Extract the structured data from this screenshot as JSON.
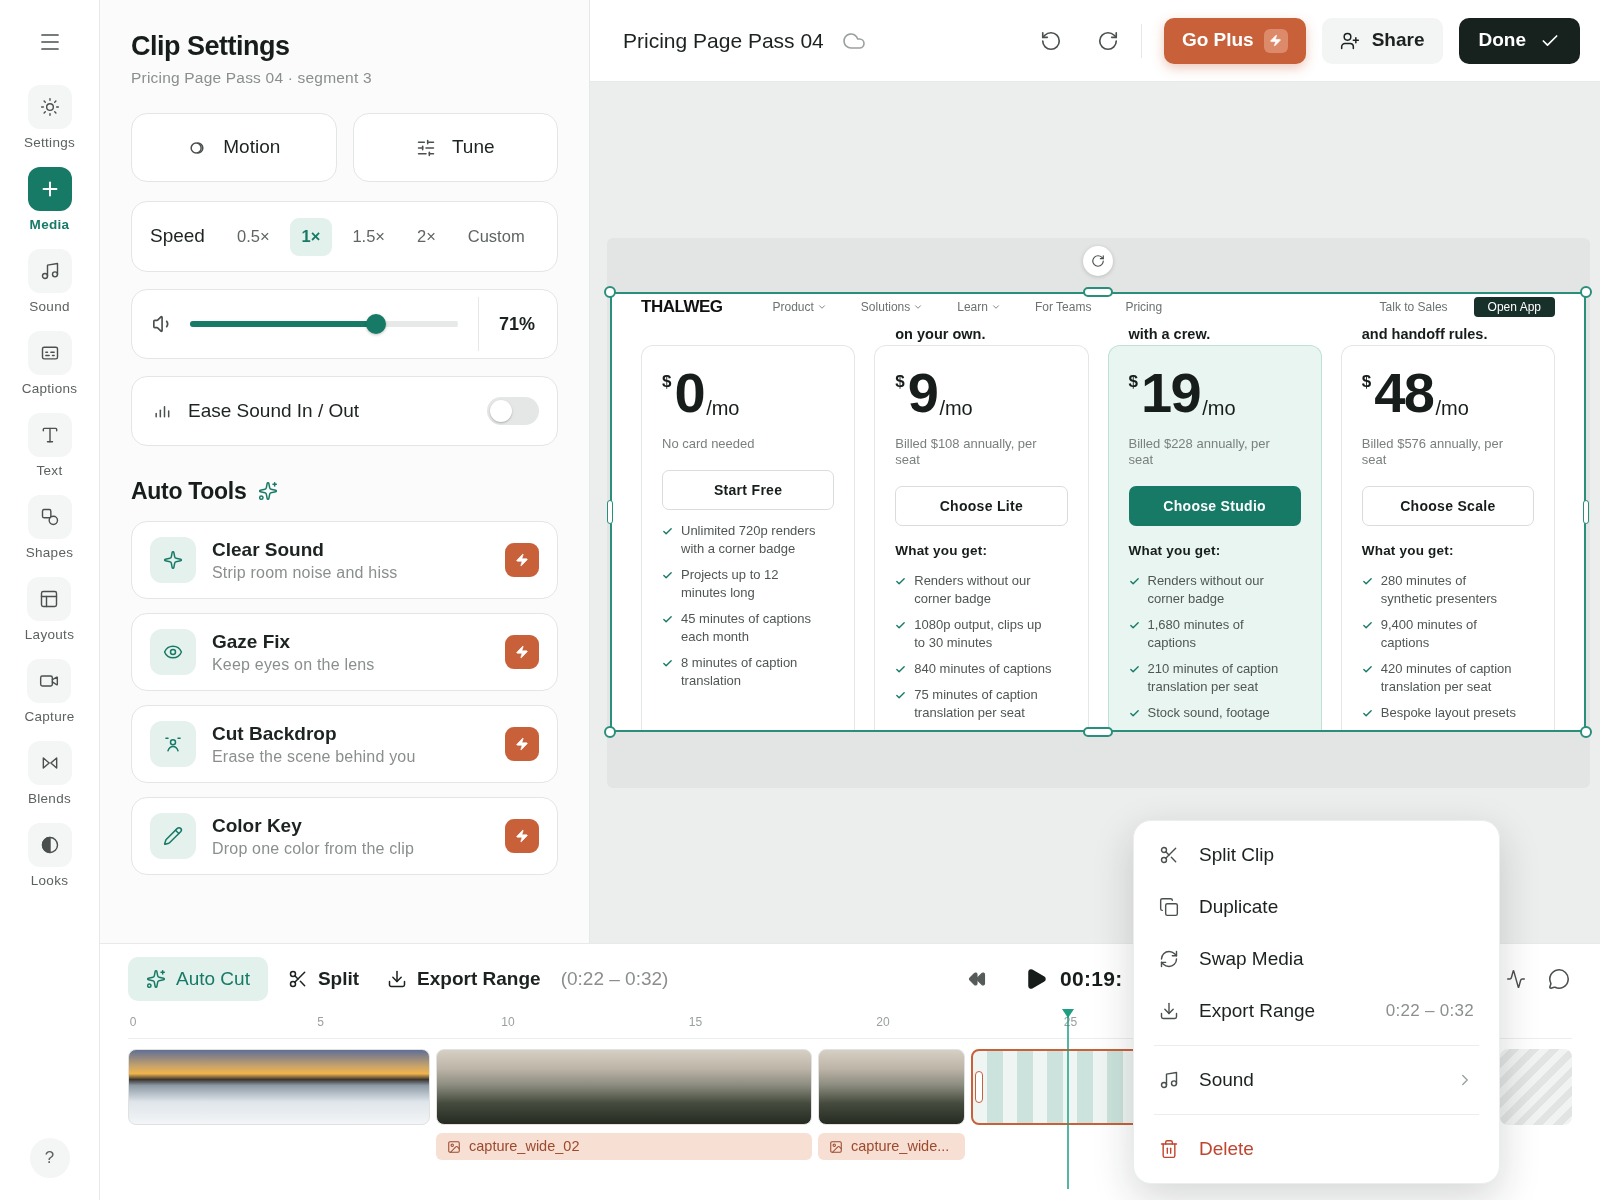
{
  "rail": {
    "items": [
      {
        "label": "Settings",
        "selected": false
      },
      {
        "label": "Media",
        "selected": true
      },
      {
        "label": "Sound",
        "selected": false
      },
      {
        "label": "Captions",
        "selected": false
      },
      {
        "label": "Text",
        "selected": false
      },
      {
        "label": "Shapes",
        "selected": false
      },
      {
        "label": "Layouts",
        "selected": false
      },
      {
        "label": "Capture",
        "selected": false
      },
      {
        "label": "Blends",
        "selected": false
      },
      {
        "label": "Looks",
        "selected": false
      }
    ],
    "help": "?"
  },
  "panel": {
    "title": "Clip Settings",
    "subtitle": "Pricing Page Pass 04 · segment 3",
    "modes": [
      "Motion",
      "Tune"
    ],
    "speed": {
      "label": "Speed",
      "options": [
        {
          "label": "0.5×",
          "selected": false
        },
        {
          "label": "1×",
          "selected": true
        },
        {
          "label": "1.5×",
          "selected": false
        },
        {
          "label": "2×",
          "selected": false
        },
        {
          "label": "Custom",
          "selected": false
        }
      ]
    },
    "volume": {
      "level": 0.71,
      "reading": "71%"
    },
    "ease": {
      "label": "Ease Sound In / Out",
      "on": false
    },
    "auto_tools": {
      "title": "Auto Tools",
      "items": [
        {
          "title": "Clear Sound",
          "description": "Strip room noise and hiss"
        },
        {
          "title": "Gaze Fix",
          "description": "Keep eyes on the lens"
        },
        {
          "title": "Cut Backdrop",
          "description": "Erase the scene behind you"
        },
        {
          "title": "Color Key",
          "description": "Drop one color from the clip"
        }
      ]
    }
  },
  "top_bar": {
    "title": "Pricing Page Pass 04",
    "buttons": [
      {
        "label": "Go Plus",
        "kind": "upgrade"
      },
      {
        "label": "Share",
        "kind": "secondary"
      },
      {
        "label": "Done",
        "kind": "primary"
      }
    ]
  },
  "preview": {
    "nav": {
      "logo": "THALWEG",
      "links": [
        {
          "label": "Product",
          "dropdown": true
        },
        {
          "label": "Solutions",
          "dropdown": true
        },
        {
          "label": "Learn",
          "dropdown": true
        },
        {
          "label": "For Teams",
          "dropdown": false
        },
        {
          "label": "Pricing",
          "dropdown": false
        }
      ],
      "secondary": "Talk to Sales",
      "cta": "Open App"
    },
    "plans": [
      {
        "currency": "$",
        "amount": "0",
        "period": "/mo",
        "note": "No card needed",
        "button": "Start Free",
        "featured": false,
        "features": [
          "Unlimited 720p renders with a corner badge",
          "Projects up to 12 minutes long",
          "45 minutes of captions each month",
          "8 minutes of caption translation"
        ]
      },
      {
        "headline": "on your own.",
        "currency": "$",
        "amount": "9",
        "period": "/mo",
        "note": "Billed $108 annually, per seat",
        "button": "Choose Lite",
        "featured": false,
        "features_heading": "What you get:",
        "features": [
          "Renders without our corner badge",
          "1080p output, clips up to 30 minutes",
          "840 minutes of captions",
          "75 minutes of caption translation per seat"
        ]
      },
      {
        "headline": "with a crew.",
        "currency": "$",
        "amount": "19",
        "period": "/mo",
        "note": "Billed $228 annually, per seat",
        "button": "Choose Studio",
        "featured": true,
        "features_heading": "What you get:",
        "features": [
          "Renders without our corner badge",
          "1,680 minutes of captions",
          "210 minutes of caption translation per seat",
          "Stock sound, footage"
        ]
      },
      {
        "headline": "and handoff rules.",
        "currency": "$",
        "amount": "48",
        "period": "/mo",
        "note": "Billed $576 annually, per seat",
        "button": "Choose Scale",
        "featured": false,
        "features_heading": "What you get:",
        "features": [
          "280 minutes of synthetic presenters",
          "9,400 minutes of captions",
          "420 minutes of caption translation per seat",
          "Bespoke layout presets"
        ]
      }
    ]
  },
  "timeline": {
    "tools": [
      {
        "label": "Auto Cut",
        "selected": true
      },
      {
        "label": "Split",
        "selected": false
      },
      {
        "label": "Export Range",
        "selected": false
      }
    ],
    "range": "(0:22 – 0:32)",
    "time": "00:19:",
    "ruler": [
      "0",
      "5",
      "10",
      "15",
      "20",
      "25"
    ],
    "clips": [
      {
        "kind": "beach",
        "selected": false
      },
      {
        "kind": "forest",
        "label": "capture_wide_02",
        "selected": false
      },
      {
        "kind": "forest",
        "label": "capture_wide...",
        "selected": false
      },
      {
        "kind": "blank",
        "selected": true
      }
    ]
  },
  "context_menu": {
    "groups": [
      {
        "items": [
          {
            "label": "Split Clip",
            "kind": "action"
          },
          {
            "label": "Duplicate",
            "kind": "action"
          },
          {
            "label": "Swap Media",
            "kind": "action"
          },
          {
            "label": "Export Range",
            "kind": "action",
            "shortcut": "0:22 – 0:32"
          }
        ]
      },
      {
        "items": [
          {
            "label": "Sound",
            "kind": "submenu"
          }
        ]
      },
      {
        "items": [
          {
            "label": "Delete",
            "kind": "danger"
          }
        ]
      }
    ]
  }
}
